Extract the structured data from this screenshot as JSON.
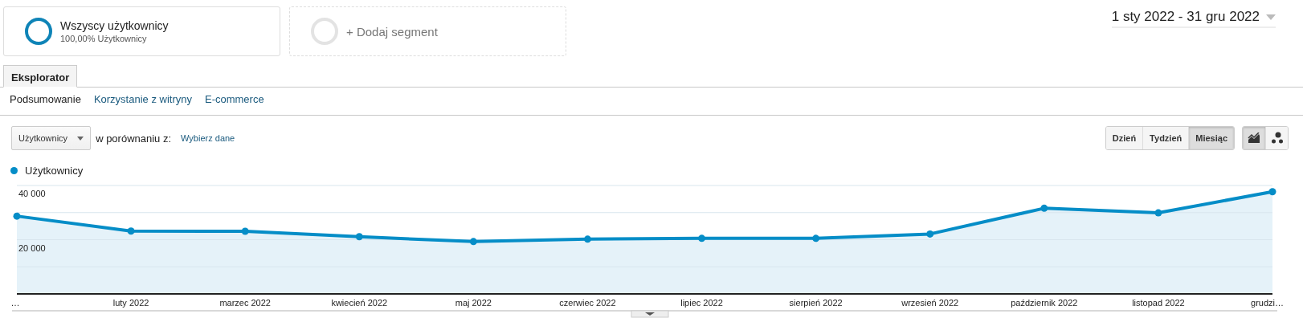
{
  "segments": [
    {
      "kind": "active",
      "title": "Wszyscy użytkownicy",
      "subtitle": "100,00% Użytkownicy"
    },
    {
      "kind": "add",
      "title": "+ Dodaj segment"
    }
  ],
  "date_range": "1 sty 2022 - 31 gru 2022",
  "tabs": [
    {
      "label": "Eksplorator",
      "selected": true
    }
  ],
  "subnav": [
    {
      "label": "Podsumowanie",
      "selected": true
    },
    {
      "label": "Korzystanie z witryny",
      "selected": false
    },
    {
      "label": "E-commerce",
      "selected": false
    }
  ],
  "metric_select": {
    "value": "Użytkownicy"
  },
  "compare_label": "w porównaniu z:",
  "compare_link": "Wybierz dane",
  "period_buttons": [
    {
      "label": "Dzień",
      "selected": false
    },
    {
      "label": "Tydzień",
      "selected": false
    },
    {
      "label": "Miesiąc",
      "selected": true
    }
  ],
  "view_buttons": [
    {
      "kind": "line",
      "selected": true
    },
    {
      "kind": "bubbles",
      "selected": false
    }
  ],
  "chart": {
    "chart_data": {
      "type": "area",
      "categories": [
        "…",
        "luty 2022",
        "marzec 2022",
        "kwiecień 2022",
        "maj 2022",
        "czerwiec 2022",
        "lipiec 2022",
        "sierpień 2022",
        "wrzesień 2022",
        "październik 2022",
        "listopad 2022",
        "grudzi…"
      ],
      "series": [
        {
          "name": "Użytkownicy",
          "color": "#058dc7",
          "values": [
            28700,
            23200,
            23100,
            21100,
            19300,
            20200,
            20500,
            20500,
            22100,
            31600,
            29900,
            37700
          ]
        }
      ],
      "ylim": [
        0,
        40000
      ],
      "yticks": [
        {
          "value": 20000,
          "label": "20 000"
        },
        {
          "value": 40000,
          "label": "40 000"
        }
      ]
    }
  }
}
